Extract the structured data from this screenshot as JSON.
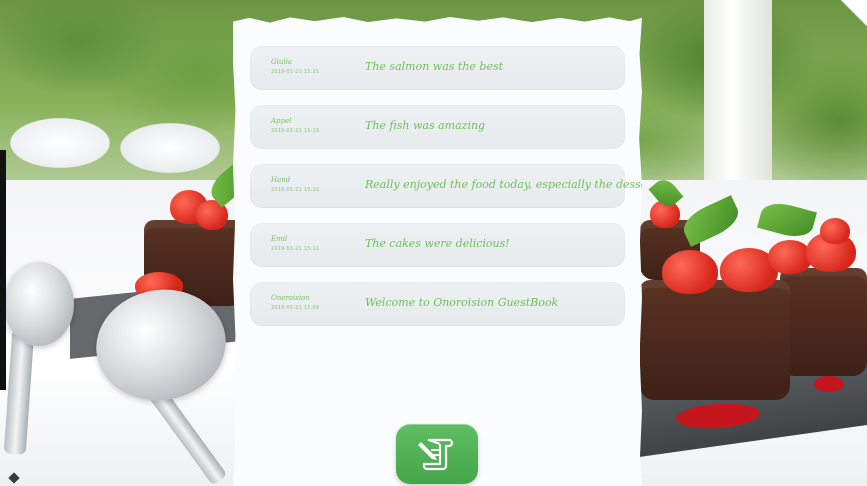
{
  "colors": {
    "accent_green": "#4fb153",
    "entry_text": "#6fbf5a",
    "entry_background": "#e9edef"
  },
  "guestbook": {
    "entries": [
      {
        "name": "Giulia",
        "date": "2019-01-21 15:21",
        "message": "The salmon was the best"
      },
      {
        "name": "Appel",
        "date": "2019-01-21 15:18",
        "message": "The fish was amazing"
      },
      {
        "name": "Hand",
        "date": "2019-01-21 15:15",
        "message": "Really enjoyed the food today, especially the desserts"
      },
      {
        "name": "Emil",
        "date": "2019-01-21 15:11",
        "message": "The cakes were delicious!"
      },
      {
        "name": "Onoroision",
        "date": "2019-01-21 15:08",
        "message": "Welcome to Onoroision GuestBook"
      }
    ],
    "sign_button": {
      "icon": "sign-guestbook-icon"
    }
  }
}
